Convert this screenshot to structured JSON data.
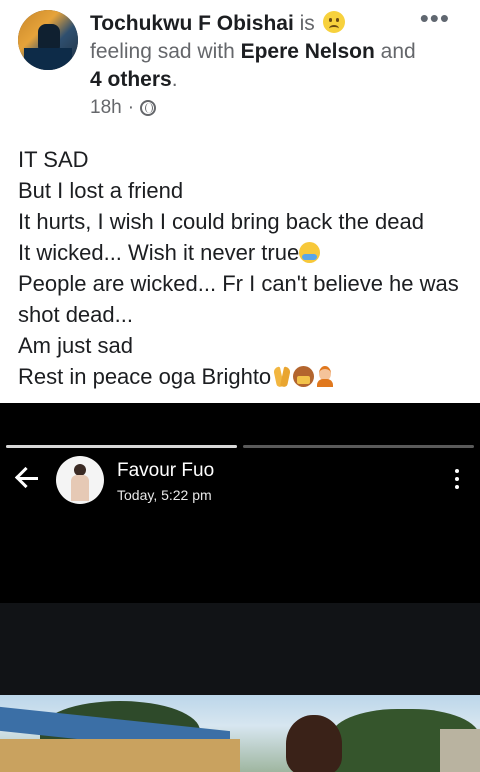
{
  "post": {
    "author": "Tochukwu F Obishai",
    "is_word": " is ",
    "feeling_text": "feeling sad with ",
    "tagged_person": "Epere Nelson",
    "and_word": " and ",
    "others": "4 others",
    "period": ".",
    "time": "18h",
    "dot": "·",
    "audience_icon": "globe-icon",
    "more_label": "•••"
  },
  "body": {
    "lines": [
      "IT SAD",
      "But I lost a friend",
      "It hurts, I wish I could bring back the dead",
      "It wicked... Wish it never true",
      "People are wicked... Fr I can't believe he was shot dead...",
      "Am just sad",
      "Rest in peace oga Brighto"
    ]
  },
  "story": {
    "name": "Favour Fuo",
    "time": "Today, 5:22 pm",
    "progress": [
      1.0,
      0.0
    ],
    "back_icon": "back-arrow-icon",
    "menu_icon": "more-vertical-icon"
  }
}
